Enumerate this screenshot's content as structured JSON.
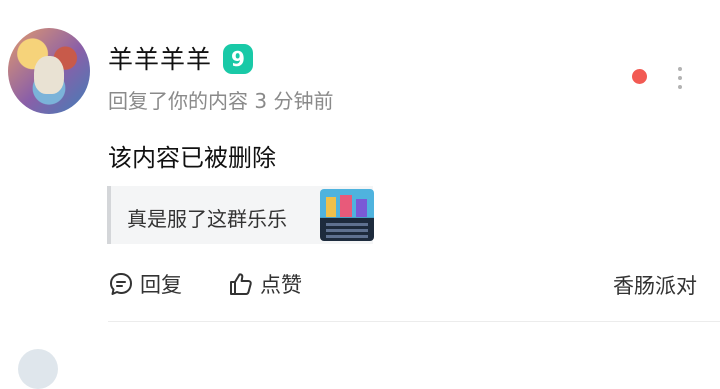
{
  "comment": {
    "username": "羊羊羊羊",
    "level": "9",
    "meta": "回复了你的内容 3 分钟前",
    "content": "该内容已被删除",
    "quote_text": "真是服了这群乐乐",
    "source": "香肠派对"
  },
  "actions": {
    "reply_label": "回复",
    "like_label": "点赞"
  },
  "icons": {
    "reply": "chat-bubble-icon",
    "like": "thumbs-up-icon",
    "more": "more-vertical-icon"
  },
  "colors": {
    "level_badge": "#19c9a7",
    "unread_dot": "#f25a53",
    "meta_text": "#8a8a8a"
  }
}
